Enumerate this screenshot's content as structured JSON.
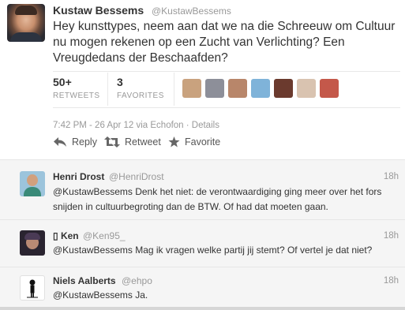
{
  "tweet": {
    "author_name": "Kustaw Bessems",
    "author_handle": "@KustawBessems",
    "text": "Hey kunsttypes, neem aan dat we na die Schreeuw om Cultuur nu mogen rekenen op een Zucht van Verlichting? Een Vreugdedans der Beschaafden?",
    "retweets_count": "50+",
    "retweets_label": "RETWEETS",
    "favorites_count": "3",
    "favorites_label": "FAVORITES",
    "meta": "7:42 PM - 26 Apr 12 via Echofon · Details",
    "actions": {
      "reply": "Reply",
      "retweet": "Retweet",
      "favorite": "Favorite"
    },
    "favoriter_avatar_colors": [
      "#c9a27e",
      "#8d8f99",
      "#b8866a",
      "#7fb3d9",
      "#6b3a2e",
      "#d9c3b0",
      "#c4584a"
    ]
  },
  "replies": [
    {
      "name": "Henri Drost",
      "handle": "@HenriDrost",
      "time": "18h",
      "text": "@KustawBessems Denk het niet: de verontwaardiging ging meer over het fors snijden in cultuurbegroting dan de BTW. Of had dat moeten gaan."
    },
    {
      "name": "▯ Ken",
      "handle": "@Ken95_",
      "time": "18h",
      "text": "@KustawBessems Mag ik vragen welke partij jij stemt? Of vertel je dat niet?"
    },
    {
      "name": "Niels Aalberts",
      "handle": "@ehpo",
      "time": "18h",
      "text": "@KustawBessems Ja."
    }
  ]
}
